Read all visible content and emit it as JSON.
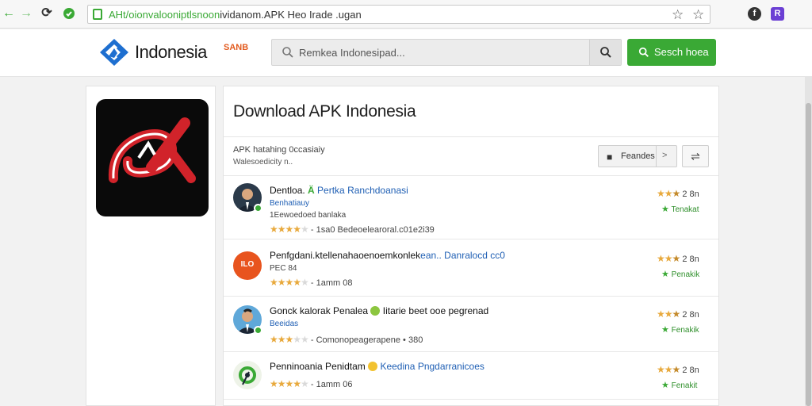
{
  "browser": {
    "url_secure": "AHt/oionvalooniptlsnoon",
    "url_rest": "ividanom.APK  Heo  Irade  .ugan",
    "ext1": "f",
    "ext2": "R"
  },
  "header": {
    "logo_text": "Indonesia",
    "logo_badge": "SANB",
    "search_placeholder": "Remkea  Indonesipad...",
    "search_button": "Sesch  hoea"
  },
  "main": {
    "title": "Download APK Indonesia",
    "subtitle1": "APK hatahing  0ccasiaiy",
    "subtitle2": "Walesoedicity n..",
    "filter_label": "Feandes",
    "filter_chevron": ">",
    "sort_icon": "⇌"
  },
  "items": [
    {
      "title_a": "Dentloa.",
      "title_b": " Pertka  Ranchdoanasi",
      "title_green": "Ä",
      "sub": "Benhatiauy",
      "line": "1Eewoedoed  banlaka",
      "meta": "- 1sa0   Bedeoelearoral.c01e2i39",
      "rating": "2 8n",
      "action": "Tenakat"
    },
    {
      "title_a": "Penfgdani.ktellenahaoenoemkonlek",
      "title_b": "ean..  Danralocd  cc0",
      "icon_text": "ILO",
      "sub": "PEC  84",
      "meta": "- 1amm   08",
      "rating": "2 8n",
      "action": "Penakik"
    },
    {
      "title_a": "Gonck  kalorak  Penalea",
      "title_b": "  Iitarie  beet  ooe  pegrenad",
      "sub": "Beeidas",
      "meta": "- Comonopeagerapene  •  380",
      "rating": "2 8n",
      "action": "Fenakik"
    },
    {
      "title_a": "Penninoania  Penidtam",
      "title_b": " Keedina  Pngdarranicoes",
      "meta": "- 1amm   06",
      "rating": "2 8n",
      "action": "Fenakit"
    }
  ],
  "colors": {
    "accent_green": "#3aa935",
    "link_blue": "#1f5fb4",
    "star": "#e8a93c",
    "logo_blue": "#1e6fd0",
    "logo_red": "#d1232a"
  }
}
